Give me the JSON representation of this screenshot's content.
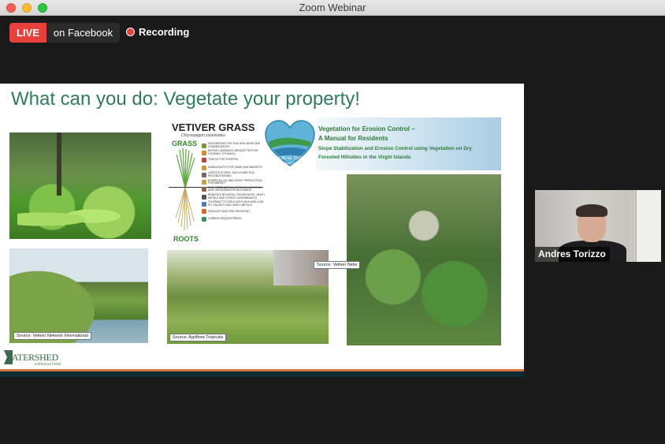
{
  "window": {
    "title": "Zoom Webinar"
  },
  "live": {
    "badge": "LIVE",
    "destination": "on Facebook"
  },
  "recording": {
    "label": "Recording"
  },
  "slide": {
    "title": "What can you do: Vegetate your property!",
    "photo_captions": [
      "Source: Vetiver Network International",
      "Source: Agriflora Tropicals",
      "Source: Vetiver Netw"
    ],
    "vetiver": {
      "title": "VETIVER GRASS",
      "subtitle": "Chrysopogon zizanioides",
      "grass_label": "GRASS",
      "roots_label": "ROOTS",
      "uses": [
        "HEDGEROWS FOR SOIL AND MOISTURE CONSERVATION",
        "BIOFUEL (BIOMASS, BRIQUETTES FOR COOKING, ETHANOL)",
        "THATCH FOR ROOFING",
        "HANDICRAFTS FOR HOME AND MARKETS",
        "LIVESTOCK FEED, MULCH AND SOIL RECONDITIONING",
        "ESSENTIAL OIL AND CRAFT PRODUCTION FOR MARKET",
        "SOIL STABILIZATION, EROSION CONTROL, AND GROUNDWATER RECHARGE",
        "REMOVES NITRATES, PHOSPHATES, HEAVY METALS AND OTHER CONTAMINANTS",
        "TOLERANT TO SOILS WITH HIGH AND LOW PH, SALINITY AND HEAVY METALS",
        "DROUGHT AND FIRE RESISTANT",
        "CARBON SEQUESTERING"
      ]
    },
    "coral_bay": {
      "line1": "CORAL BAY",
      "line2": "Community Council"
    },
    "manual": {
      "line1": "Vegetation for Erosion Control –",
      "line2": "A Manual for Residents",
      "line3": "Slope Stabilization and Erosion Control using Vegetation on Dry",
      "line4": "Forested Hillsides in the Virgin Islands"
    },
    "logo": {
      "name": "ATERSHED",
      "sub": "CONSULTING"
    }
  },
  "participant": {
    "name": "Andres Torizzo"
  },
  "colors": {
    "live_red": "#e8403a",
    "title_green": "#2e7d5a",
    "stripe_orange": "#d9743c",
    "stripe_navy": "#0f2c36"
  }
}
